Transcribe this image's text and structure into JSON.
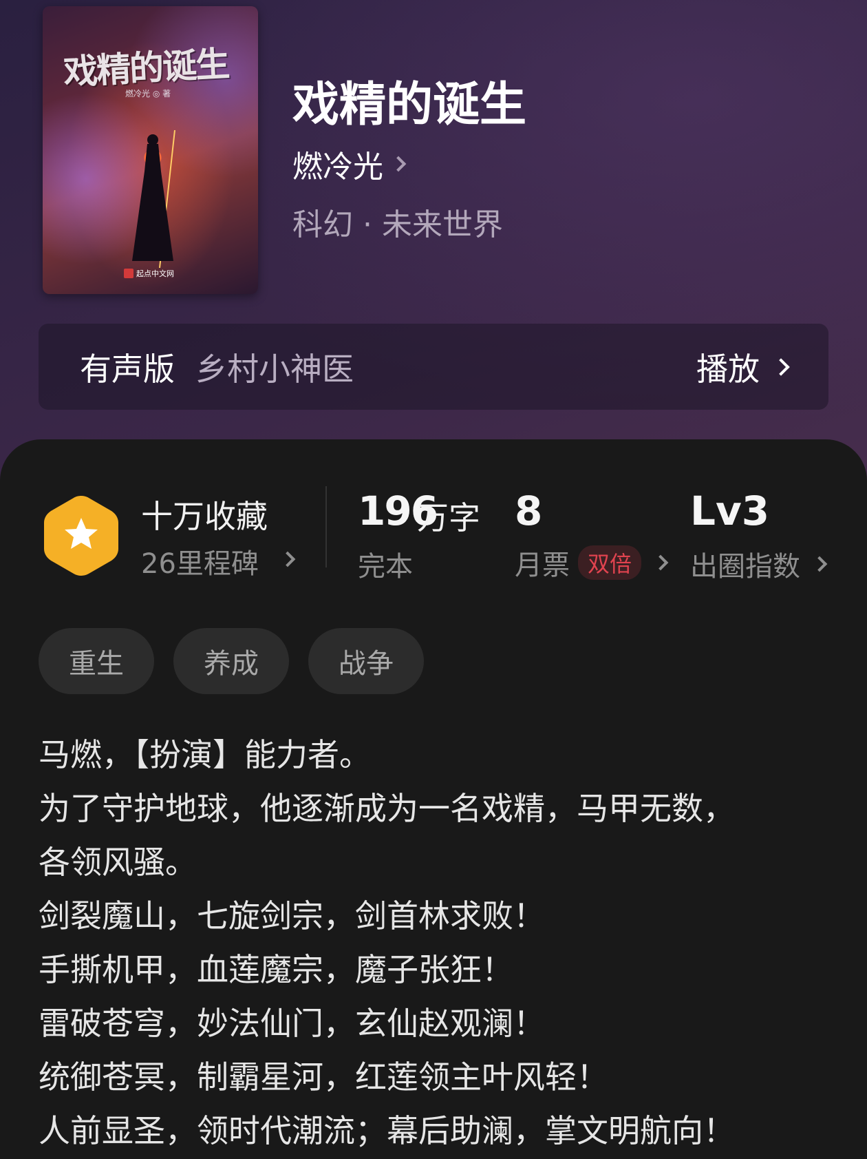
{
  "cover": {
    "title": "戏精的诞生",
    "author": "燃冷光 ◎ 著",
    "publisher": "起点中文网"
  },
  "book": {
    "title": "戏精的诞生",
    "author": "燃冷光",
    "genre": "科幻 · 未来世界"
  },
  "audio": {
    "label": "有声版",
    "title": "乡村小神医",
    "play_label": "播放"
  },
  "stats": {
    "favorites": "十万收藏",
    "milestones": "26里程碑",
    "word_count": "196",
    "word_unit": "万字",
    "status": "完本",
    "monthly_votes": "8",
    "monthly_votes_label": "月票",
    "double_badge": "双倍",
    "level": "Lv3",
    "level_label": "出圈指数"
  },
  "tags": [
    "重生",
    "养成",
    "战争"
  ],
  "synopsis": [
    "马燃，【扮演】能力者。",
    "为了守护地球，他逐渐成为一名戏精，马甲无数，",
    "各领风骚。",
    "剑裂魔山，七旋剑宗，剑首林求败！",
    "手撕机甲，血莲魔宗，魔子张狂！",
    "雷破苍穹，妙法仙门，玄仙赵观澜！",
    "统御苍冥，制霸星河，红莲领主叶风轻！",
    "人前显圣，领时代潮流；幕后助澜，掌文明航向！"
  ],
  "colors": {
    "badge": "#f5b026",
    "double_badge": "#e0434f",
    "panel_bg": "#191919"
  }
}
